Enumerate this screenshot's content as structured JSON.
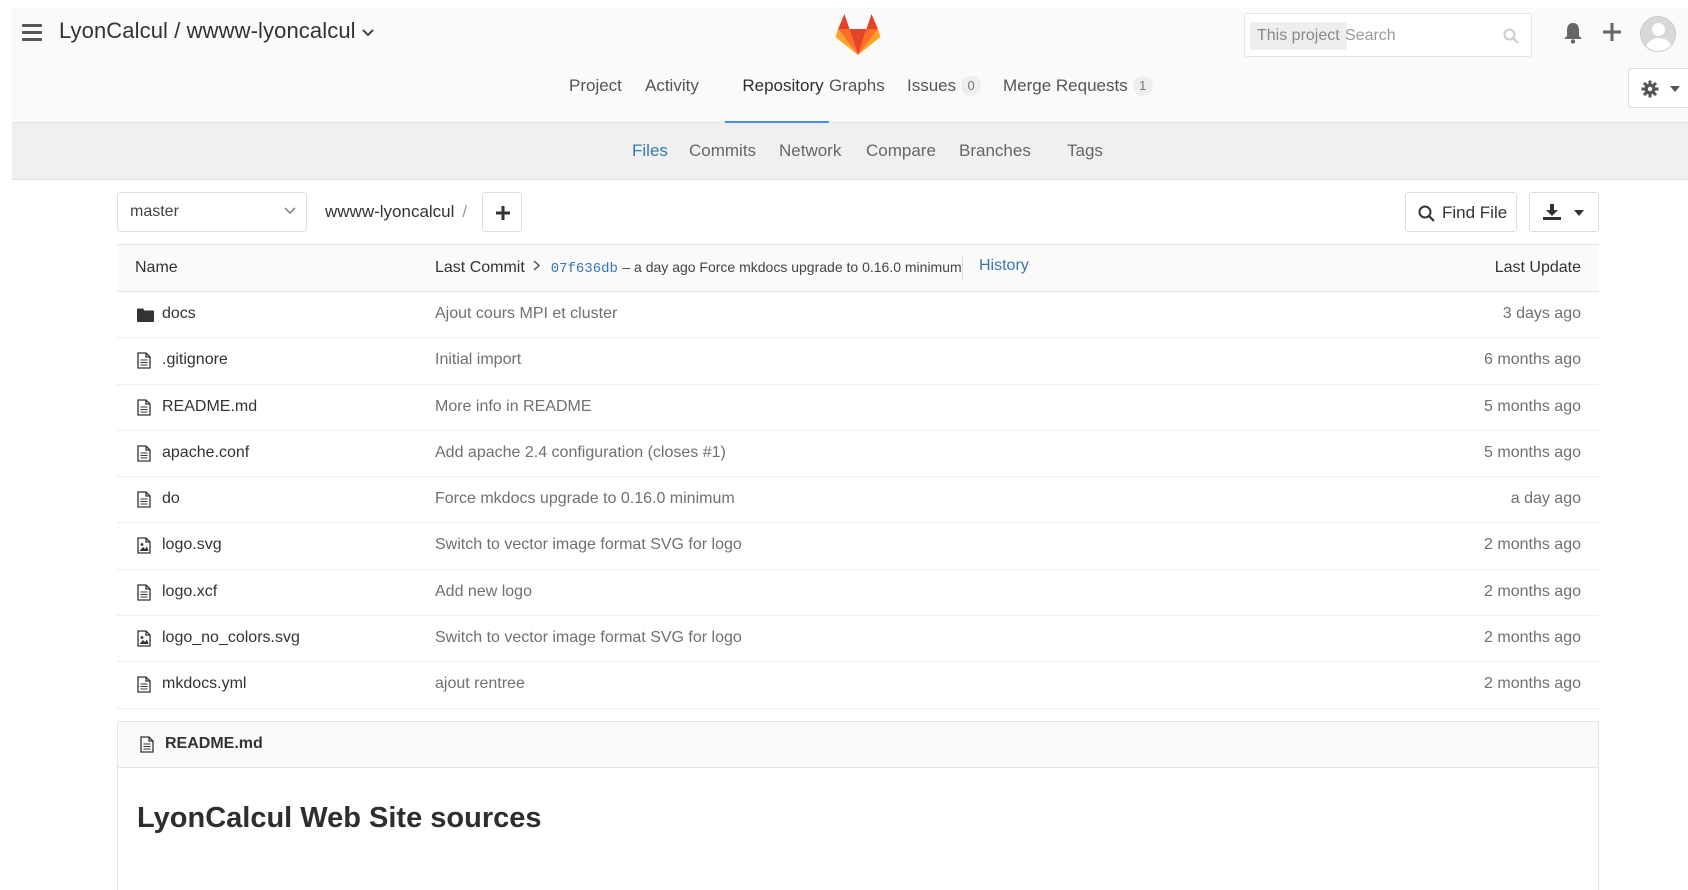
{
  "header": {
    "project_path": "LyonCalcul / wwww-lyoncalcul",
    "search_scope": "This project",
    "search_placeholder": "Search"
  },
  "main_nav": [
    {
      "label": "Project"
    },
    {
      "label": "Activity"
    },
    {
      "label": "Repository",
      "active": true
    },
    {
      "label": "Graphs"
    },
    {
      "label": "Issues",
      "count": "0"
    },
    {
      "label": "Merge Requests",
      "count": "1"
    }
  ],
  "sub_nav": [
    {
      "label": "Files",
      "active": true
    },
    {
      "label": "Commits"
    },
    {
      "label": "Network"
    },
    {
      "label": "Compare"
    },
    {
      "label": "Branches"
    },
    {
      "label": "Tags"
    }
  ],
  "toolbar": {
    "branch": "master",
    "breadcrumb_root": "wwww-lyoncalcul",
    "breadcrumb_sep": "/",
    "find_file": "Find File"
  },
  "tree": {
    "col_name": "Name",
    "col_last_commit": "Last Commit",
    "last_commit_sha": "07f636db",
    "last_commit_info": "– a day ago Force mkdocs upgrade to 0.16.0 minimum",
    "history": "History",
    "col_last_update": "Last Update",
    "rows": [
      {
        "name": "docs",
        "icon": "folder-icon",
        "message": "Ajout cours MPI et cluster",
        "date": "3 days ago"
      },
      {
        "name": ".gitignore",
        "icon": "file-icon",
        "message": "Initial import",
        "date": "6 months ago"
      },
      {
        "name": "README.md",
        "icon": "file-icon",
        "message": "More info in README",
        "date": "5 months ago"
      },
      {
        "name": "apache.conf",
        "icon": "file-icon",
        "message": "Add apache 2.4 configuration (closes #1)",
        "date": "5 months ago"
      },
      {
        "name": "do",
        "icon": "file-icon",
        "message": "Force mkdocs upgrade to 0.16.0 minimum",
        "date": "a day ago"
      },
      {
        "name": "logo.svg",
        "icon": "image-file-icon",
        "message": "Switch to vector image format SVG for logo",
        "date": "2 months ago"
      },
      {
        "name": "logo.xcf",
        "icon": "file-icon",
        "message": "Add new logo",
        "date": "2 months ago"
      },
      {
        "name": "logo_no_colors.svg",
        "icon": "image-file-icon",
        "message": "Switch to vector image format SVG for logo",
        "date": "2 months ago"
      },
      {
        "name": "mkdocs.yml",
        "icon": "file-icon",
        "message": "ajout rentree",
        "date": "2 months ago"
      }
    ]
  },
  "readme": {
    "filename": "README.md",
    "heading": "LyonCalcul Web Site sources"
  },
  "colors": {
    "link": "#3777b0",
    "active_underline": "#4a8bee",
    "logo_orange": "#fc6d26",
    "logo_red": "#e24329",
    "logo_yellow": "#fca326"
  }
}
